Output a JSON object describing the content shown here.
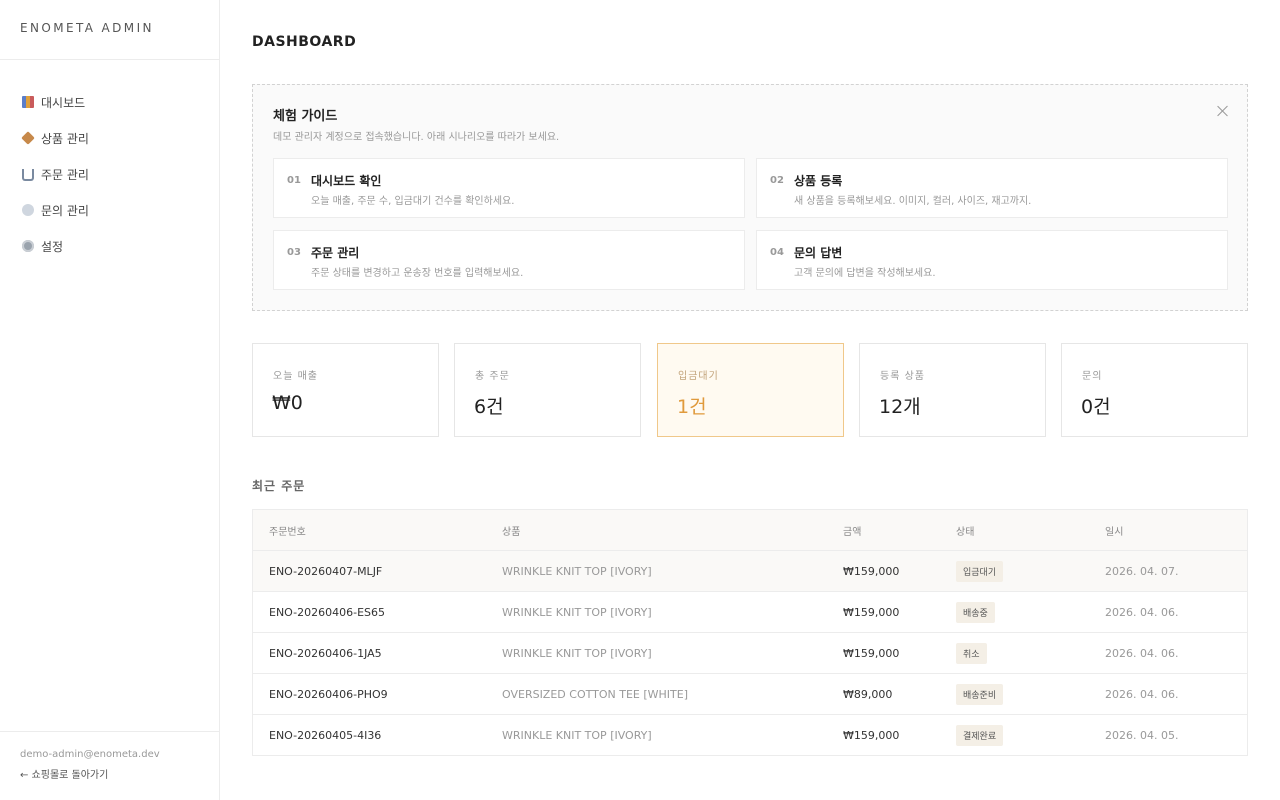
{
  "brand": "ENOMETA ADMIN",
  "nav": [
    {
      "label": "대시보드",
      "icon": "chart-icon"
    },
    {
      "label": "상품 관리",
      "icon": "box-icon"
    },
    {
      "label": "주문 관리",
      "icon": "cart-icon"
    },
    {
      "label": "문의 관리",
      "icon": "chat-icon"
    },
    {
      "label": "설정",
      "icon": "gear-icon"
    }
  ],
  "footer": {
    "email": "demo-admin@enometa.dev",
    "back_label": "← 쇼핑몰로 돌아가기"
  },
  "page_title": "DASHBOARD",
  "guide": {
    "title": "체험 가이드",
    "subtitle": "데모 관리자 계정으로 접속했습니다. 아래 시나리오를 따라가 보세요.",
    "steps": [
      {
        "num": "01",
        "title": "대시보드 확인",
        "desc": "오늘 매출, 주문 수, 입금대기 건수를 확인하세요."
      },
      {
        "num": "02",
        "title": "상품 등록",
        "desc": "새 상품을 등록해보세요. 이미지, 컬러, 사이즈, 재고까지."
      },
      {
        "num": "03",
        "title": "주문 관리",
        "desc": "주문 상태를 변경하고 운송장 번호를 입력해보세요."
      },
      {
        "num": "04",
        "title": "문의 답변",
        "desc": "고객 문의에 답변을 작성해보세요."
      }
    ]
  },
  "stats": [
    {
      "label": "오늘 매출",
      "value": "₩0"
    },
    {
      "label": "총 주문",
      "value": "6건"
    },
    {
      "label": "입금대기",
      "value": "1건"
    },
    {
      "label": "등록 상품",
      "value": "12개"
    },
    {
      "label": "문의",
      "value": "0건"
    }
  ],
  "recent_orders": {
    "title": "최근 주문",
    "columns": [
      "주문번호",
      "상품",
      "금액",
      "상태",
      "일시"
    ],
    "rows": [
      {
        "id": "ENO-20260407-MLJF",
        "product": "WRINKLE KNIT TOP [IVORY]",
        "amount": "₩159,000",
        "status": "입금대기",
        "date": "2026. 04. 07."
      },
      {
        "id": "ENO-20260406-ES65",
        "product": "WRINKLE KNIT TOP [IVORY]",
        "amount": "₩159,000",
        "status": "배송중",
        "date": "2026. 04. 06."
      },
      {
        "id": "ENO-20260406-1JA5",
        "product": "WRINKLE KNIT TOP [IVORY]",
        "amount": "₩159,000",
        "status": "취소",
        "date": "2026. 04. 06."
      },
      {
        "id": "ENO-20260406-PHO9",
        "product": "OVERSIZED COTTON TEE [WHITE]",
        "amount": "₩89,000",
        "status": "배송준비",
        "date": "2026. 04. 06."
      },
      {
        "id": "ENO-20260405-4I36",
        "product": "WRINKLE KNIT TOP [IVORY]",
        "amount": "₩159,000",
        "status": "결제완료",
        "date": "2026. 04. 05."
      }
    ]
  },
  "colors": {
    "accent": "#e09a3c",
    "highlight_border": "#f0c88a",
    "highlight_bg": "#fffaf1"
  }
}
